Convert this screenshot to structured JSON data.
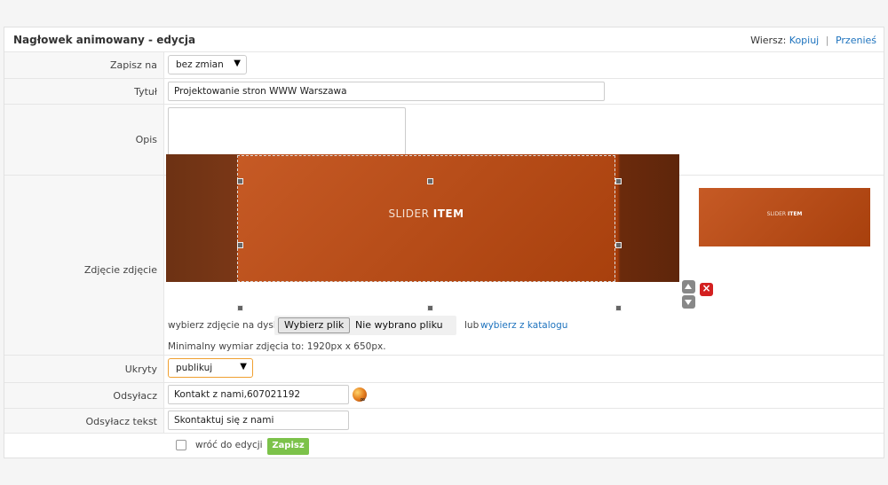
{
  "header": {
    "title": "Nagłowek animowany - edycja",
    "row_label": "Wiersz:",
    "copy_link": "Kopiuj",
    "move_link": "Przenieś",
    "separator": "|"
  },
  "form": {
    "save_to": {
      "label": "Zapisz na",
      "value": "bez zmian"
    },
    "title": {
      "label": "Tytuł",
      "value": "Projektowanie stron WWW Warszawa"
    },
    "description": {
      "label": "Opis",
      "value": ""
    },
    "image": {
      "label": "Zdjęcie zdjęcie",
      "slider_text_light": "SLIDER ",
      "slider_text_bold": "ITEM",
      "choose_from_disk": "wybierz zdjęcie na dysku",
      "file_button": "Wybierz plik",
      "file_status": "Nie wybrano pliku",
      "or_text": "lub",
      "catalog_link": "wybierz z katalogu",
      "min_size_note": "Minimalny wymiar zdjęcia to: 1920px x 650px."
    },
    "hidden": {
      "label": "Ukryty",
      "value": "publikuj"
    },
    "link": {
      "label": "Odsyłacz",
      "value": "Kontakt z nami,607021192"
    },
    "link_text": {
      "label": "Odsyłacz tekst",
      "value": "Skontaktuj się z nami"
    }
  },
  "footer": {
    "return_label": "wróć do edycji",
    "return_checked": false,
    "save_button": "Zapisz"
  },
  "colors": {
    "link": "#1e73be",
    "save_button": "#7cc24a",
    "delete_icon": "#d32020",
    "slider_bg": "#b94a17"
  },
  "icons": {
    "move_up": "triangle-up-icon",
    "move_down": "triangle-down-icon",
    "delete": "close-icon",
    "link_picker": "globe-link-icon",
    "select_arrow": "caret-down-icon"
  }
}
